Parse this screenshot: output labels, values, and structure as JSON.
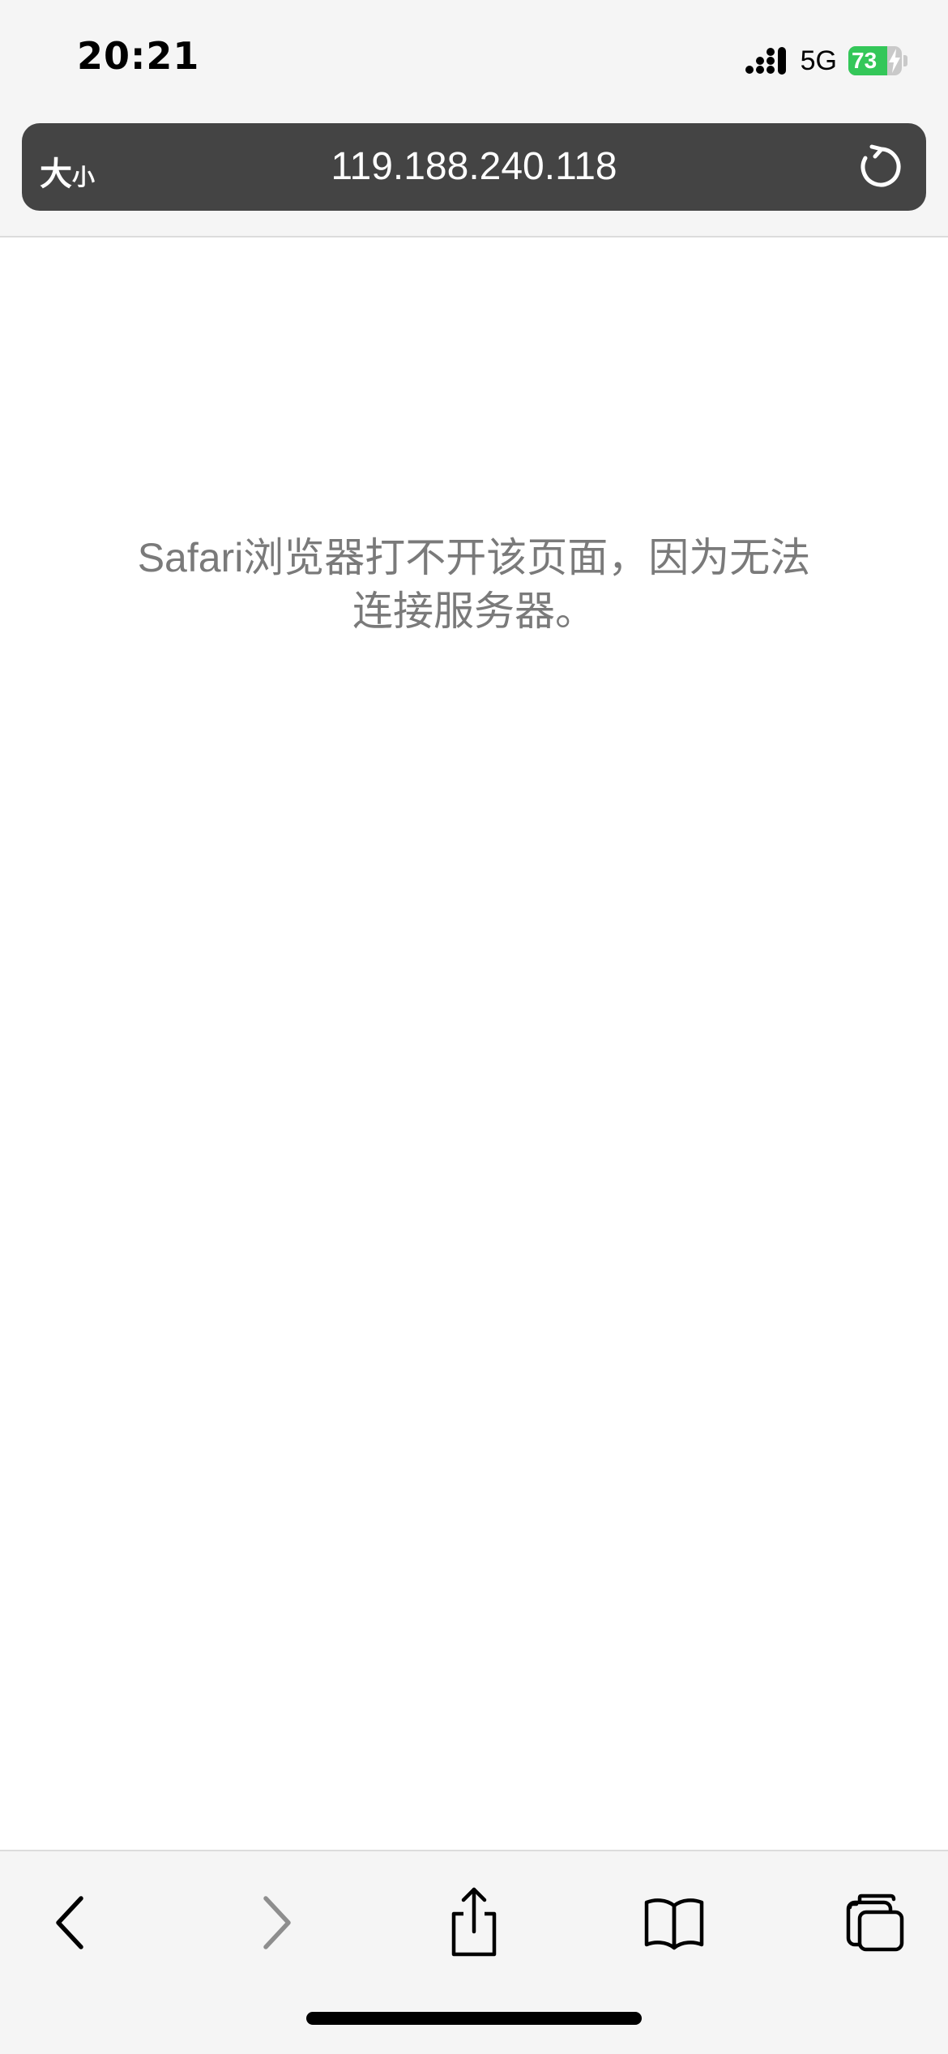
{
  "status_bar": {
    "time": "20:21",
    "network": "5G",
    "battery_level": "73",
    "battery_fraction": 0.73,
    "battery_color": "#34c759",
    "icons": [
      "signal-icon",
      "battery-icon",
      "charging-bolt-icon"
    ]
  },
  "address_bar": {
    "text_size_big": "大",
    "text_size_small": "小",
    "url": "119.188.240.118",
    "reload_icon": "reload-icon"
  },
  "page": {
    "error_line1": "Safari浏览器打不开该页面，因为无法",
    "error_line2": "连接服务器。"
  },
  "toolbar": {
    "icons": [
      "back-icon",
      "forward-icon",
      "share-icon",
      "bookmarks-icon",
      "tabs-icon"
    ],
    "forward_enabled": false
  }
}
